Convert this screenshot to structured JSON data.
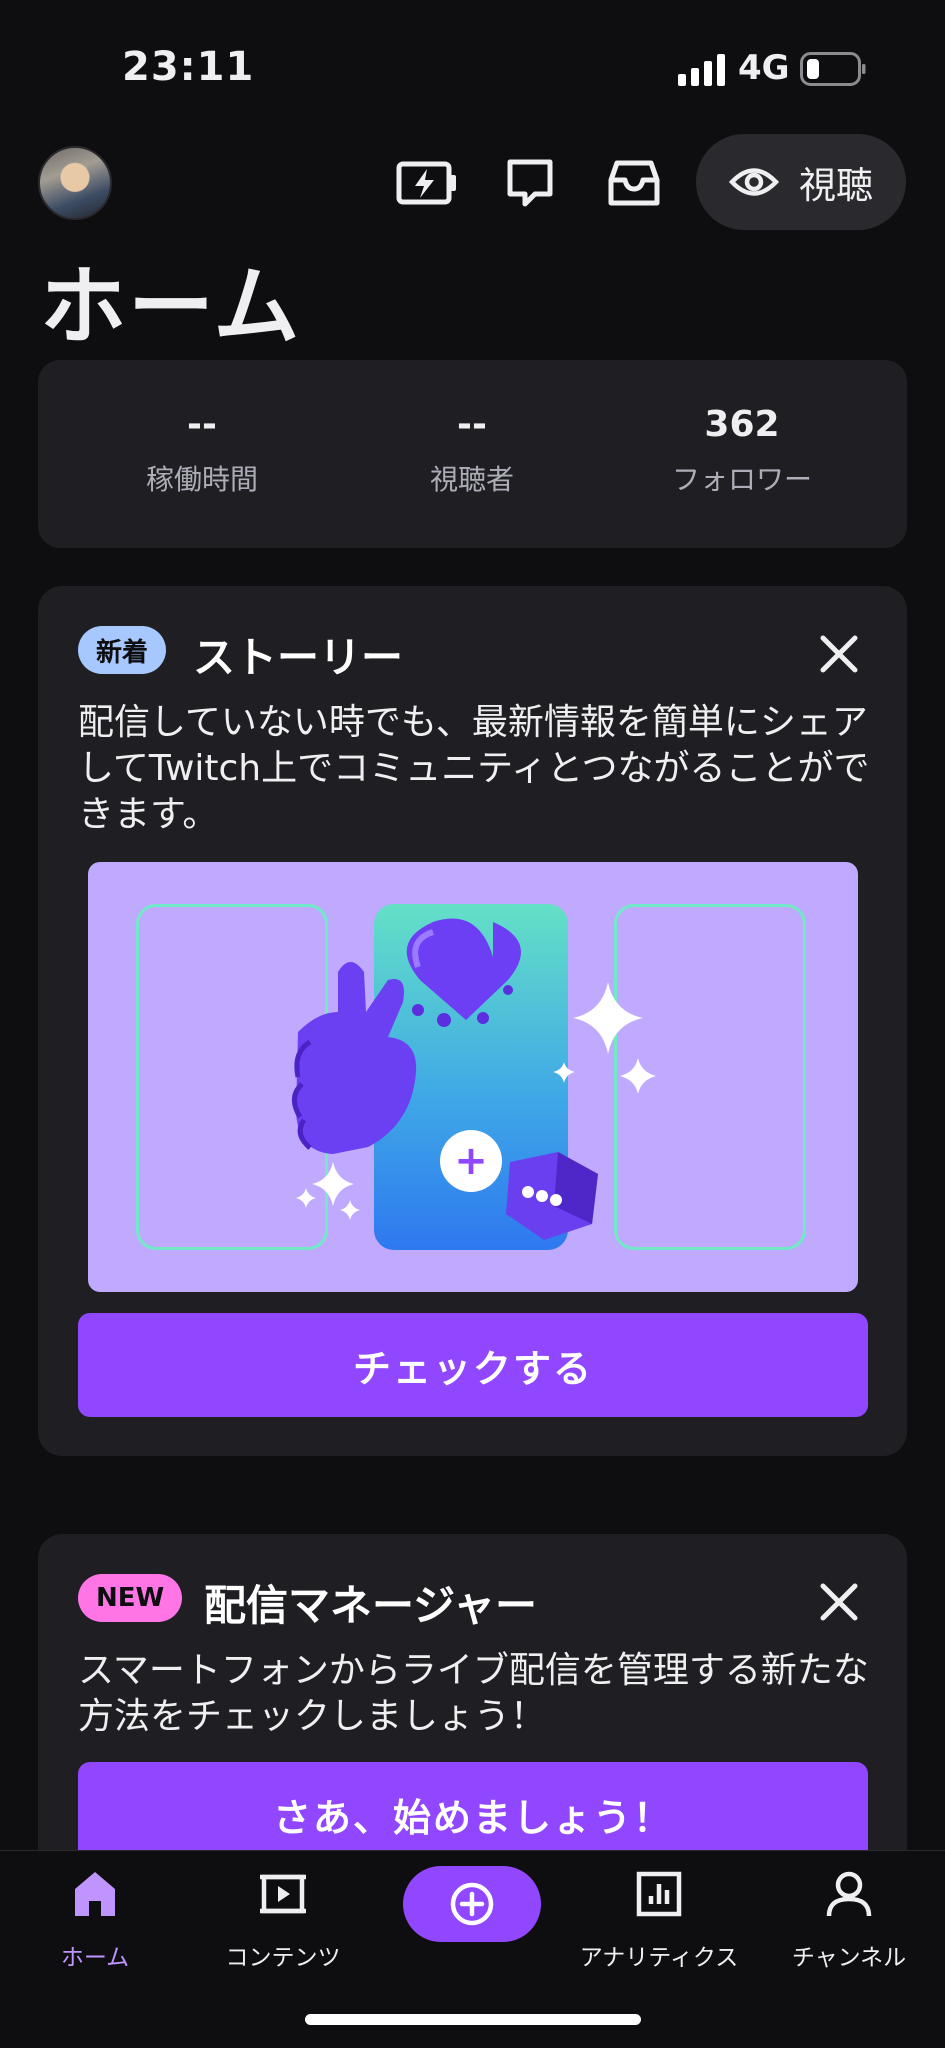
{
  "status_bar": {
    "time": "23:11",
    "network": "4G"
  },
  "header": {
    "watch_label": "視聴",
    "title": "ホーム"
  },
  "stats": [
    {
      "value": "--",
      "label": "稼働時間"
    },
    {
      "value": "--",
      "label": "視聴者"
    },
    {
      "value": "362",
      "label": "フォロワー"
    }
  ],
  "stories_card": {
    "badge": "新着",
    "title": "ストーリー",
    "description": "配信していない時でも、最新情報を簡単にシェアしてTwitch上でコミュニティとつながることができます。",
    "cta": "チェックする"
  },
  "manager_card": {
    "badge": "NEW",
    "title": "配信マネージャー",
    "description": "スマートフォンからライブ配信を管理する新たな方法をチェックしましょう！",
    "cta": "さあ、始めましょう！"
  },
  "bottom_nav": {
    "items": [
      {
        "label": "ホーム",
        "icon": "home-icon",
        "active": true
      },
      {
        "label": "コンテンツ",
        "icon": "film-icon",
        "active": false
      },
      {
        "label": "",
        "icon": "plus-circle-icon",
        "active": false
      },
      {
        "label": "アナリティクス",
        "icon": "chart-icon",
        "active": false
      },
      {
        "label": "チャンネル",
        "icon": "person-icon",
        "active": false
      }
    ]
  },
  "colors": {
    "background": "#0e0e10",
    "card": "#1f1f23",
    "accent": "#9147ff",
    "active_nav": "#bf94ff",
    "badge_new_story": "#a7c7ff",
    "badge_new": "#ff75e6"
  }
}
